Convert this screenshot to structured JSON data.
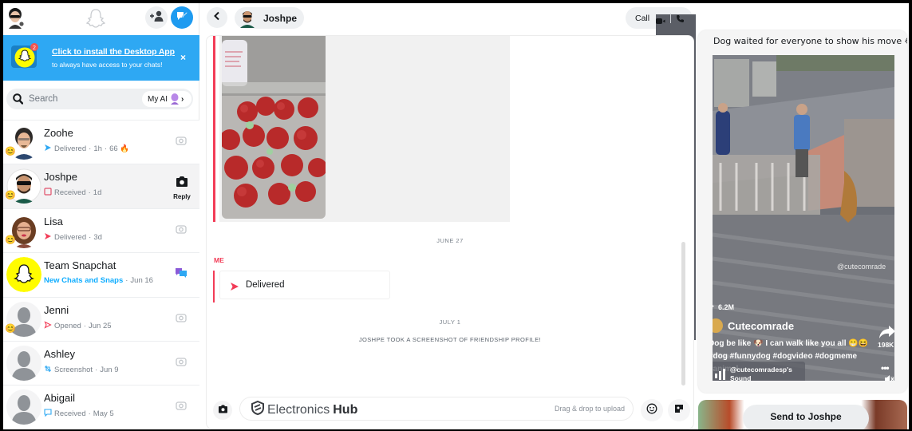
{
  "sidebar": {
    "banner": {
      "title": "Click to install the Desktop App",
      "subtitle": "to always have access to your chats!",
      "close": "×",
      "badge": "2"
    },
    "search": {
      "placeholder": "Search",
      "my_ai_label": "My AI",
      "chevron": "›"
    },
    "chats": [
      {
        "name": "Zoohe",
        "status": "Delivered",
        "time": "1h",
        "streak": "66 🔥",
        "status_icon": "filled-arrow-blue",
        "action": "camera-icon",
        "emoji": "😊"
      },
      {
        "name": "Joshpe",
        "status": "Received",
        "time": "1d",
        "status_icon": "hollow-square-red",
        "action": "reply-camera",
        "reply_label": "Reply",
        "emoji": "😊",
        "selected": true
      },
      {
        "name": "Lisa",
        "status": "Delivered",
        "time": "3d",
        "status_icon": "filled-arrow-red",
        "action": "camera-icon",
        "emoji": "😊"
      },
      {
        "name": "Team Snapchat",
        "status": "New Chats and Snaps",
        "time": "Jun 16",
        "status_icon": "none",
        "action": "chat-bubbles-icon"
      },
      {
        "name": "Jenni",
        "status": "Opened",
        "time": "Jun 25",
        "status_icon": "hollow-arrow-red",
        "action": "camera-icon",
        "emoji": "😊"
      },
      {
        "name": "Ashley",
        "status": "Screenshot",
        "time": "Jun 9",
        "status_icon": "screenshot-blue",
        "action": "camera-icon"
      },
      {
        "name": "Abigail",
        "status": "Received",
        "time": "May 5",
        "status_icon": "hollow-bubble-blue",
        "action": "camera-icon"
      }
    ],
    "separator": "·"
  },
  "chat": {
    "contact_name": "Joshpe",
    "call_label": "Call",
    "date_1": "JUNE 27",
    "me_label": "ME",
    "delivered_text": "Delivered",
    "date_2": "JULY 1",
    "screenshot_note": "JOSHPE TOOK A SCREENSHOT OF FRIENDSHIP PROFILE!",
    "composer": {
      "brand_light": "Electronics",
      "brand_bold": "Hub",
      "hint": "Drag & drop to upload"
    }
  },
  "story": {
    "title": "Dog waited for everyone to show his move 😂",
    "watermark": "@cutecomrade",
    "views": "6.2M",
    "creator": "Cutecomrade",
    "caption": "Dog be like 🐶 I can walk like you all 😁😆 #dog #funnydog #dogvideo #dogmeme #animal",
    "share_count": "198K",
    "more": "•••",
    "sound_line1": "@cutecomradesp's",
    "sound_line2": "Sound",
    "send_label": "Send to Joshpe"
  },
  "colors": {
    "accent_blue": "#1e9bf0",
    "banner_blue": "#2ea8f3",
    "snap_red": "#f23c57",
    "snap_yellow": "#fffc00",
    "status_blue": "#0fadff"
  }
}
